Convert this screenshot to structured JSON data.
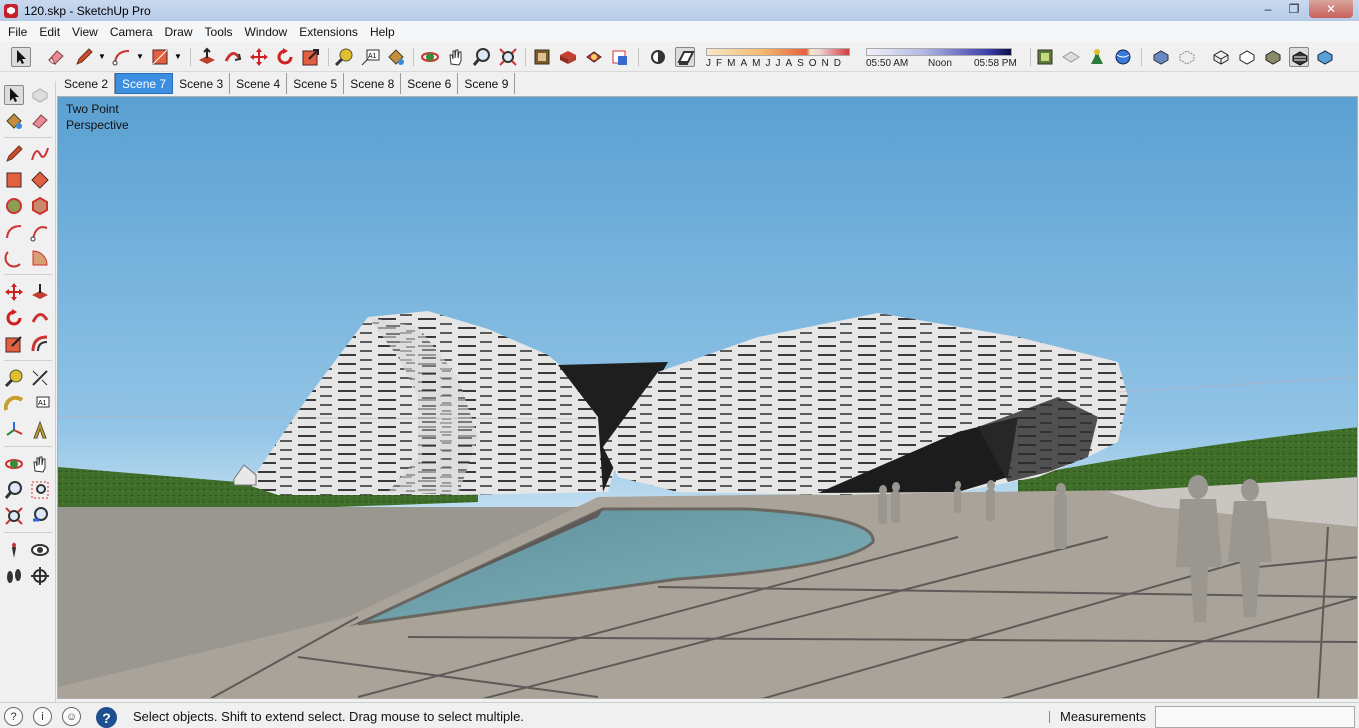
{
  "window": {
    "title": "120.skp - SketchUp Pro",
    "minimize": "–",
    "restore": "❐",
    "close": "✕"
  },
  "menu": [
    "File",
    "Edit",
    "View",
    "Camera",
    "Draw",
    "Tools",
    "Window",
    "Extensions",
    "Help"
  ],
  "shadow": {
    "months": "JFMAMJJASOND",
    "time_start": "05:50 AM",
    "time_mid": "Noon",
    "time_end": "05:58 PM"
  },
  "scenes": {
    "tabs": [
      "Scene 2",
      "Scene 7",
      "Scene 3",
      "Scene 4",
      "Scene 5",
      "Scene 8",
      "Scene 6",
      "Scene 9"
    ],
    "active": "Scene 7"
  },
  "viewport": {
    "camera_line1": "Two Point",
    "camera_line2": "Perspective"
  },
  "status": {
    "message": "Select objects. Shift to extend select. Drag mouse to select multiple.",
    "measurements_label": "Measurements",
    "measurements_value": "",
    "help": "?"
  },
  "icons": {
    "toolbar": [
      "select-icon",
      "eraser-icon",
      "pencil-icon",
      "arc-icon",
      "rectangle-icon",
      "push-pull-icon",
      "follow-me-icon",
      "move-icon",
      "rotate-icon",
      "scale-icon",
      "tape-measure-icon",
      "text-icon",
      "paint-bucket-icon",
      "orbit-icon",
      "pan-icon",
      "zoom-icon",
      "zoom-extents-icon",
      "warehouse-icon",
      "extension-warehouse-icon",
      "layout-icon",
      "style-builder-icon",
      "shadow-toggle-icon",
      "fog-icon",
      "geo-location-icon",
      "add-location-icon",
      "photo-texture-icon",
      "preview-google-earth-icon",
      "xray-icon",
      "back-edges-icon",
      "wireframe-icon",
      "hidden-line-icon",
      "shaded-icon",
      "shaded-textures-icon",
      "monochrome-icon"
    ],
    "left": [
      "select-icon",
      "make-component-icon",
      "paint-bucket-icon",
      "eraser-icon",
      "line-icon",
      "freehand-icon",
      "rectangle-icon",
      "rotated-rectangle-icon",
      "circle-icon",
      "polygon-icon",
      "arc-icon",
      "two-point-arc-icon",
      "three-point-arc-icon",
      "pie-icon",
      "move-icon",
      "push-pull-icon",
      "rotate-icon",
      "follow-me-icon",
      "scale-icon",
      "offset-icon",
      "tape-measure-icon",
      "dimension-icon",
      "protractor-icon",
      "text-icon",
      "axes-icon",
      "3d-text-icon",
      "orbit-icon",
      "pan-icon",
      "zoom-icon",
      "zoom-window-icon",
      "zoom-extents-icon",
      "previous-view-icon",
      "position-camera-icon",
      "look-around-icon",
      "walk-icon",
      "section-plane-icon"
    ]
  }
}
